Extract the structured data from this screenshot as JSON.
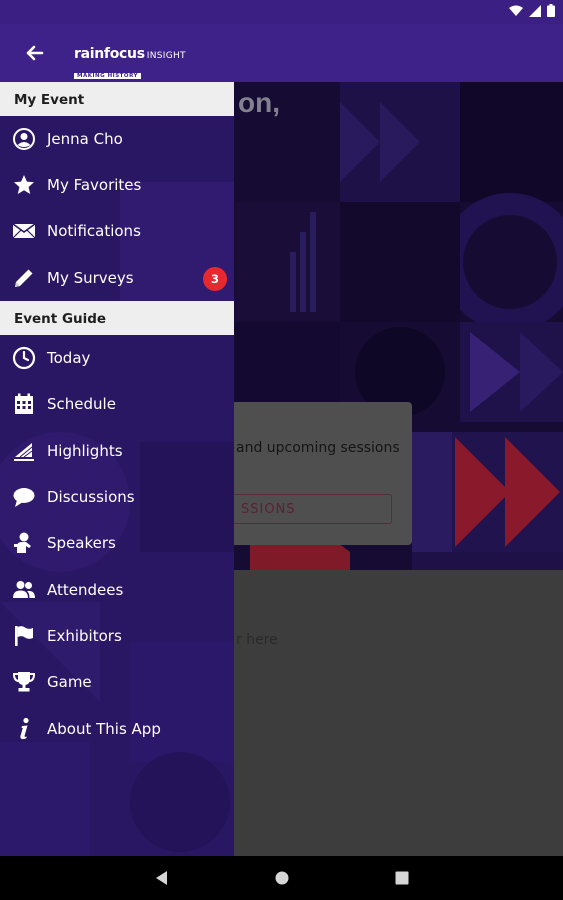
{
  "app": {
    "logo_brand": "rainfocus",
    "logo_product": "INSIGHT",
    "logo_tagline": "MAKING HISTORY"
  },
  "background": {
    "greeting_fragment": "on,",
    "card_text": "and upcoming sessions",
    "card_button": "SSIONS",
    "lower_text": "r here"
  },
  "drawer": {
    "sections": {
      "my_event": "My Event",
      "event_guide": "Event Guide"
    },
    "items": [
      {
        "label": "Jenna Cho",
        "icon": "account-circle-icon"
      },
      {
        "label": "My Favorites",
        "icon": "star-icon"
      },
      {
        "label": "Notifications",
        "icon": "envelope-icon"
      },
      {
        "label": "My Surveys",
        "icon": "pencil-icon",
        "badge": "3"
      },
      {
        "label": "Today",
        "icon": "clock-icon"
      },
      {
        "label": "Schedule",
        "icon": "calendar-icon"
      },
      {
        "label": "Highlights",
        "icon": "highlights-icon"
      },
      {
        "label": "Discussions",
        "icon": "chat-bubble-icon"
      },
      {
        "label": "Speakers",
        "icon": "speaker-icon"
      },
      {
        "label": "Attendees",
        "icon": "people-icon"
      },
      {
        "label": "Exhibitors",
        "icon": "flag-icon"
      },
      {
        "label": "Game",
        "icon": "trophy-icon"
      },
      {
        "label": "About This App",
        "icon": "info-icon"
      }
    ]
  },
  "colors": {
    "app_bar": "#3f2289",
    "drawer": "#2a1763",
    "badge": "#e8282f",
    "section_header": "#eeeeef"
  }
}
